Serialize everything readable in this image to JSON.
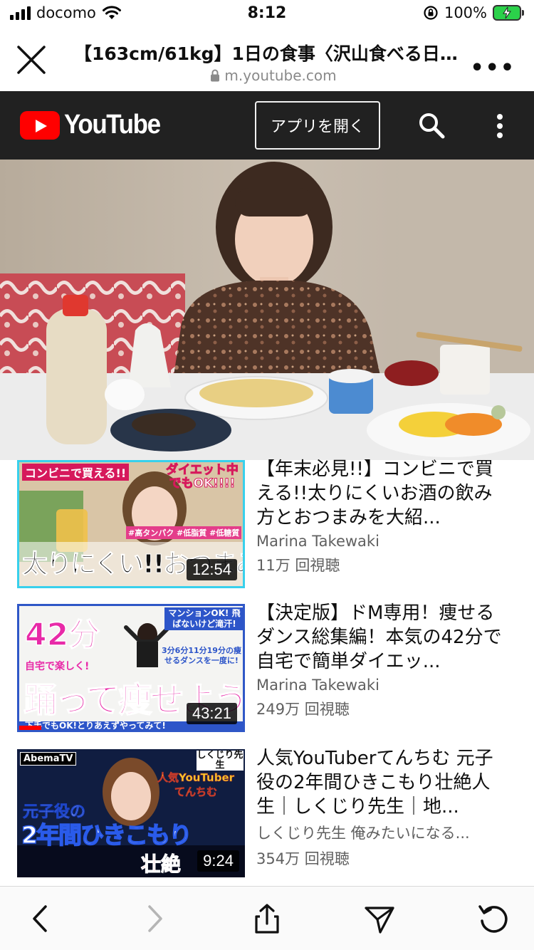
{
  "status": {
    "carrier": "docomo",
    "time": "8:12",
    "battery": "100%"
  },
  "browser": {
    "title": "【163cm/61kg】1日の食事〈沢山食べる日編...",
    "url": "m.youtube.com"
  },
  "youtube": {
    "logo_text": "YouTube",
    "open_app_label": "アプリを開く"
  },
  "videos": [
    {
      "title": "【年末必見!!】コンビニで買える!!太りにくいお酒の飲み方とおつまみを大紹...",
      "channel": "Marina Takewaki",
      "views": "11万 回視聴",
      "duration": "12:54",
      "thumb_top_left": "コンビニで買える!!",
      "thumb_top_right": "ダイエット中でもOK!!!!",
      "thumb_tags": "#高タンパク #低脂質 #低糖質",
      "thumb_main": "太りにくい!!おつまみ"
    },
    {
      "title": "【決定版】ドM専用！痩せるダンス総集編！本気の42分で自宅で簡単ダイエッ...",
      "channel": "Marina Takewaki",
      "views": "249万 回視聴",
      "duration": "43:21",
      "progress": 0.1,
      "thumb_minutes": "42分",
      "thumb_note1": "マンションOK! 飛ばないけど滝汗!",
      "thumb_note2": "3分6分11分19分の痩せるダンスを一度に!",
      "thumb_home": "自宅で楽しく!",
      "thumb_main": "踊って痩せよう",
      "thumb_bottom": "下手でもOK!とりあえずやってみて!"
    },
    {
      "title": "人気YouTuberてんちむ 元子役の2年間ひきこもり壮絶人生｜しくじり先生｜地...",
      "channel": "しくじり先生 俺みたいになる...",
      "views": "354万 回視聴",
      "duration": "9:24",
      "thumb_brand": "AbemaTV",
      "thumb_show": "しくじり先生",
      "thumb_name": "人気YouTuber てんちむ",
      "thumb_line1": "元子役の",
      "thumb_main": "2年間ひきこもり",
      "thumb_end": "壮絶"
    }
  ],
  "colors": {
    "yt_header": "#212121",
    "yt_red": "#ff0000",
    "meta_gray": "#606060"
  }
}
